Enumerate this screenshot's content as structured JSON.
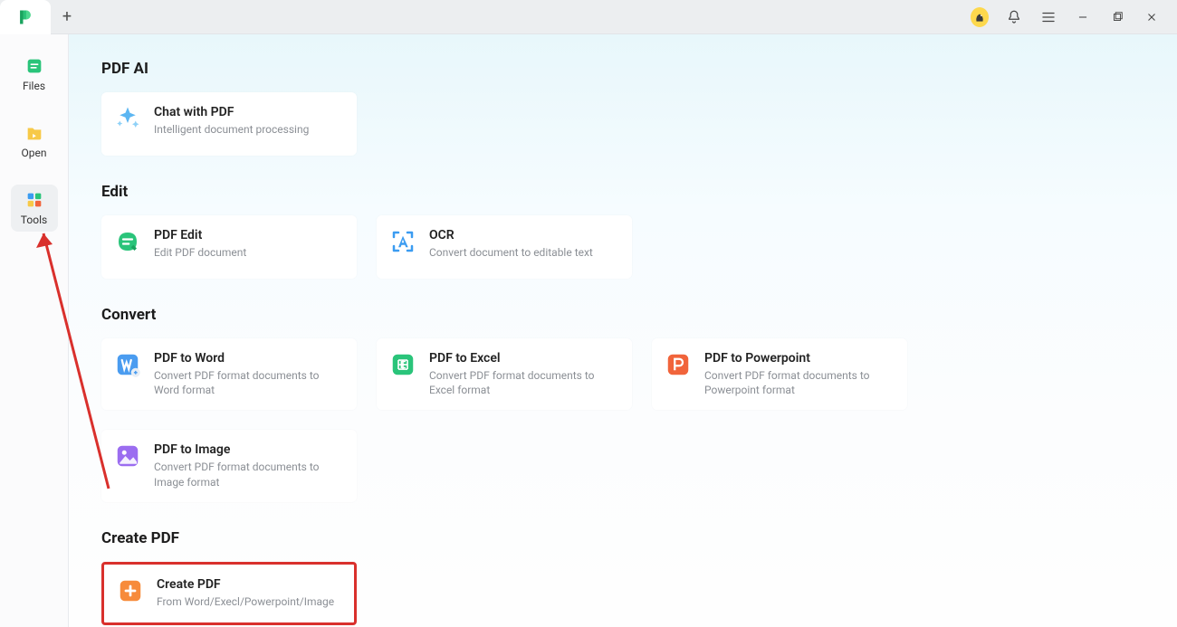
{
  "sidebar": {
    "items": [
      {
        "label": "Files"
      },
      {
        "label": "Open"
      },
      {
        "label": "Tools"
      }
    ]
  },
  "sections": {
    "pdf_ai": {
      "title": "PDF AI",
      "cards": [
        {
          "title": "Chat with PDF",
          "desc": "Intelligent document processing"
        }
      ]
    },
    "edit": {
      "title": "Edit",
      "cards": [
        {
          "title": "PDF Edit",
          "desc": "Edit PDF document"
        },
        {
          "title": "OCR",
          "desc": "Convert document to editable text"
        }
      ]
    },
    "convert": {
      "title": "Convert",
      "cards": [
        {
          "title": "PDF to Word",
          "desc": "Convert PDF format documents to Word format"
        },
        {
          "title": "PDF to Excel",
          "desc": "Convert PDF format documents to Excel format"
        },
        {
          "title": "PDF to Powerpoint",
          "desc": "Convert PDF format documents to Powerpoint format"
        },
        {
          "title": "PDF to Image",
          "desc": "Convert PDF format documents to Image format"
        }
      ]
    },
    "create": {
      "title": "Create PDF",
      "cards": [
        {
          "title": "Create PDF",
          "desc": "From Word/Execl/Powerpoint/Image"
        }
      ]
    }
  }
}
